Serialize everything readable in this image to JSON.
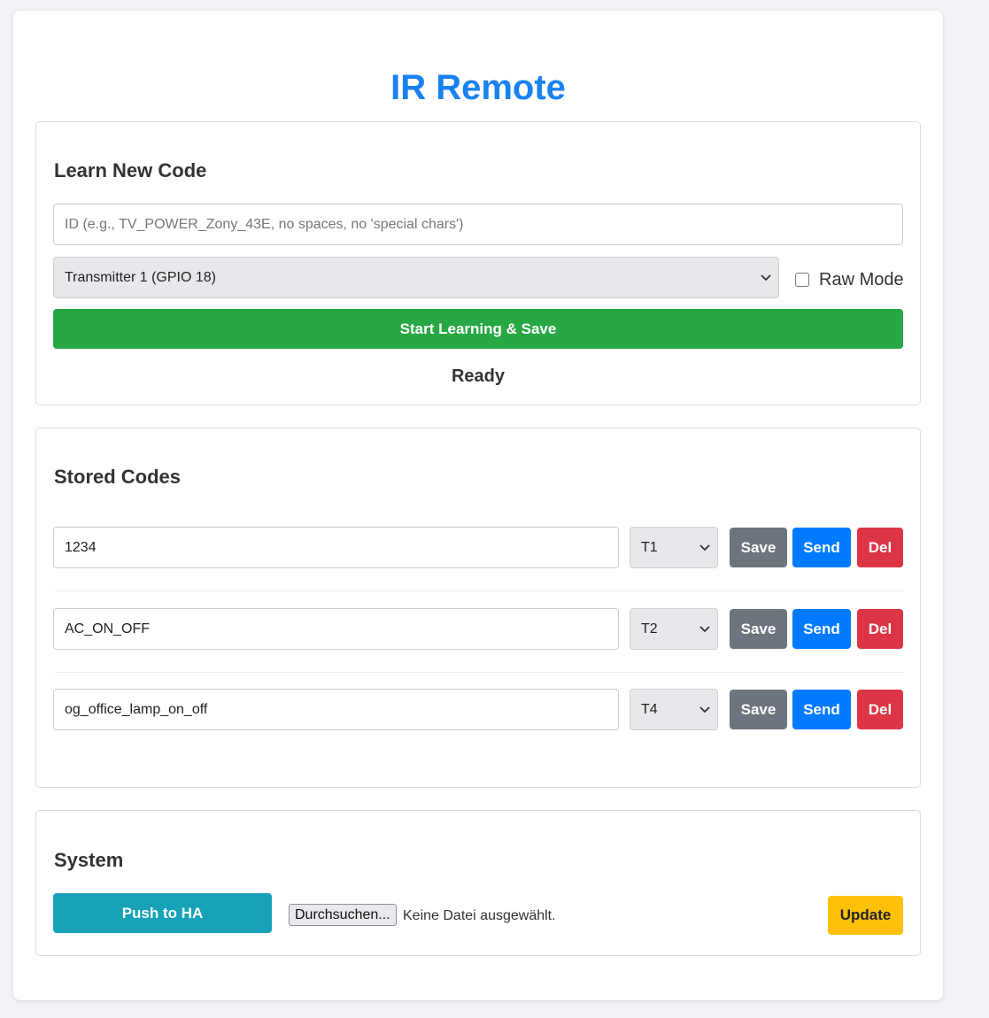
{
  "app": {
    "title": "IR Remote"
  },
  "learn": {
    "title": "Learn New Code",
    "id_placeholder": "ID (e.g., TV_POWER_Zony_43E, no spaces, no 'special chars')",
    "id_value": "",
    "transmitter_selected": "Transmitter 1 (GPIO 18)",
    "raw_mode_label": "Raw Mode",
    "raw_mode_checked": false,
    "start_button": "Start Learning & Save",
    "status": "Ready"
  },
  "stored": {
    "title": "Stored Codes",
    "save_label": "Save",
    "send_label": "Send",
    "del_label": "Del",
    "codes": [
      {
        "id": "1234",
        "transmitter": "T1"
      },
      {
        "id": "AC_ON_OFF",
        "transmitter": "T2"
      },
      {
        "id": "og_office_lamp_on_off",
        "transmitter": "T4"
      }
    ]
  },
  "system": {
    "title": "System",
    "push_button": "Push to HA",
    "browse_button": "Durchsuchen...",
    "no_file_text": "Keine Datei ausgewählt.",
    "update_button": "Update"
  },
  "colors": {
    "accent_blue": "#1a82f0",
    "success_green": "#28a745",
    "info_teal": "#17a2b8",
    "warning_yellow": "#ffc107",
    "danger_red": "#dc3545",
    "secondary_gray": "#6c757d",
    "primary_blue": "#007bff"
  }
}
